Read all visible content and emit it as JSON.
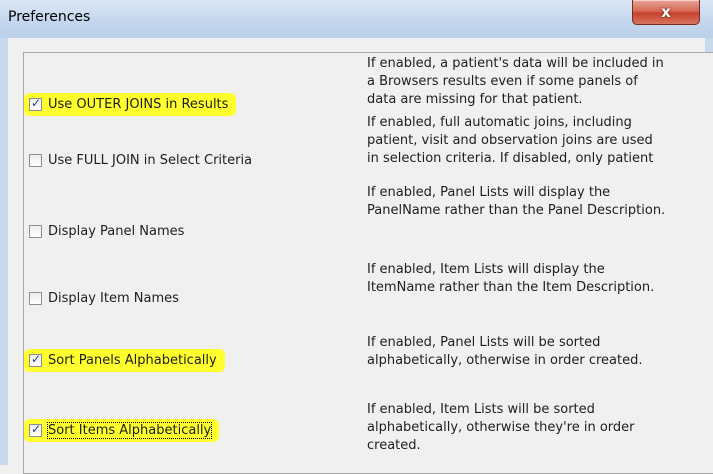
{
  "window": {
    "title": "Preferences",
    "close_symbol": "x"
  },
  "options": [
    {
      "label": "Use OUTER JOINS in Results",
      "checked": true,
      "highlighted": true,
      "description": [
        "If enabled, a patient's data will be included in",
        "a Browsers results even if some panels of",
        "data are missing for that patient."
      ]
    },
    {
      "label": "Use FULL JOIN in Select Criteria",
      "checked": false,
      "highlighted": false,
      "description": [
        "If enabled, full automatic joins, including",
        "patient, visit and observation joins are used",
        "in selection criteria.  If disabled, only patient"
      ]
    },
    {
      "label": "Display Panel Names",
      "checked": false,
      "highlighted": false,
      "description": [
        "If enabled, Panel Lists will display the",
        "PanelName rather than the Panel Description."
      ]
    },
    {
      "label": "Display Item Names",
      "checked": false,
      "highlighted": false,
      "description": [
        "If enabled, Item Lists will display the",
        "ItemName rather than the Item Description."
      ]
    },
    {
      "label": "Sort Panels Alphabetically",
      "checked": true,
      "highlighted": true,
      "description": [
        "If enabled, Panel Lists will be sorted",
        "alphabetically, otherwise in order created."
      ]
    },
    {
      "label": "Sort Items Alphabetically",
      "checked": true,
      "highlighted": true,
      "focused": true,
      "description": [
        "If enabled, Item Lists will be sorted",
        "alphabetically, otherwise they're in order",
        "created."
      ]
    }
  ],
  "colors": {
    "highlight": "#ffff2e",
    "titlebar": "#c5d7ee",
    "close_button": "#c5432c"
  }
}
